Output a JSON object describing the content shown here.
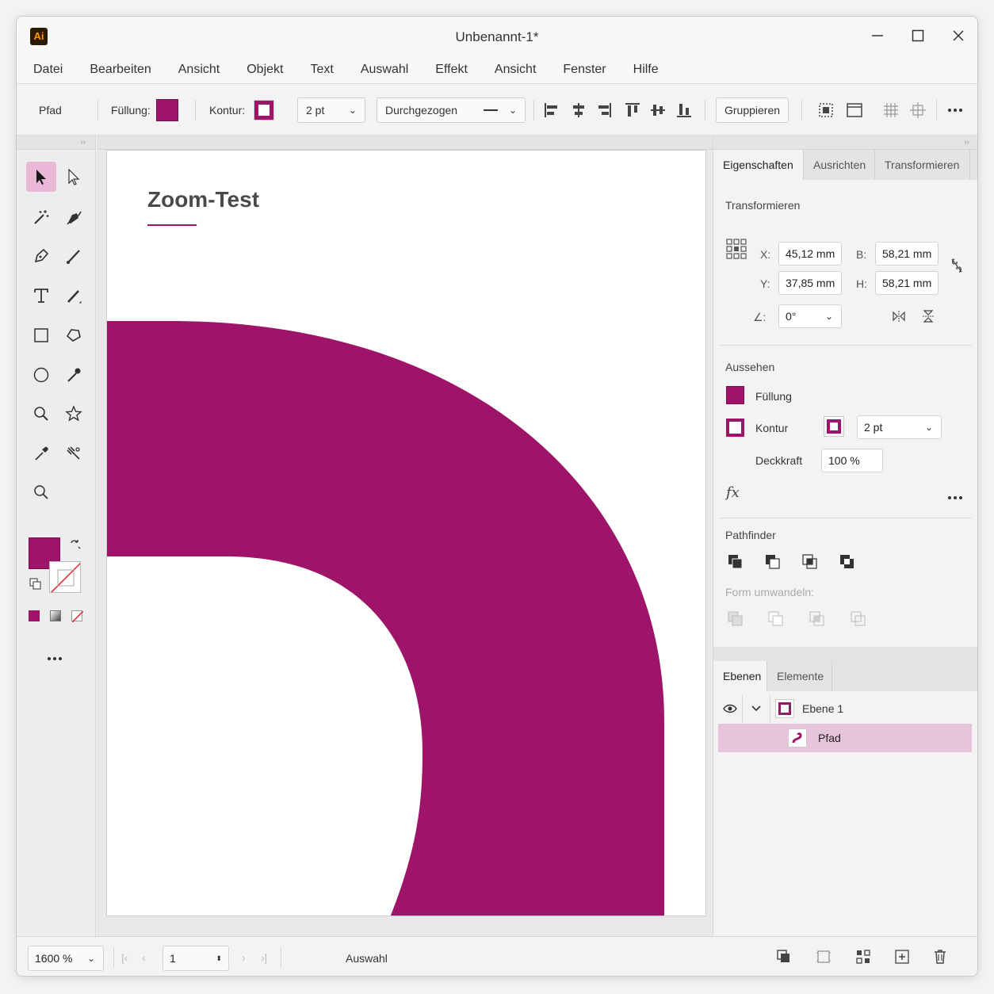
{
  "window": {
    "title": "Unbenannt-1*",
    "app_icon_text": "Ai"
  },
  "menu": [
    "Datei",
    "Bearbeiten",
    "Ansicht",
    "Objekt",
    "Text",
    "Auswahl",
    "Effekt",
    "Ansicht",
    "Fenster",
    "Hilfe"
  ],
  "controlbar": {
    "object_type": "Pfad",
    "fill_label": "Füllung:",
    "stroke_label": "Kontur:",
    "stroke_weight": "2 pt",
    "stroke_style": "Durchgezogen",
    "group_button": "Gruppieren"
  },
  "colors": {
    "accent": "#9e1468",
    "active_tool_bg": "#e8b8d6",
    "selected_layer_bg": "#e6c4d9"
  },
  "artboard": {
    "heading": "Zoom-Test"
  },
  "properties": {
    "tabs": [
      "Eigenschaften",
      "Ausrichten",
      "Transformieren"
    ],
    "transform_title": "Transformieren",
    "x_label": "X:",
    "x_value": "45,12 mm",
    "y_label": "Y:",
    "y_value": "37,85 mm",
    "w_label": "B:",
    "w_value": "58,21 mm",
    "h_label": "H:",
    "h_value": "58,21 mm",
    "angle_label": "∠:",
    "angle_value": "0°",
    "appearance_title": "Aussehen",
    "fill_label": "Füllung",
    "stroke_label": "Kontur",
    "stroke_weight": "2 pt",
    "opacity_label": "Deckkraft",
    "opacity_value": "100 %",
    "fx_label": "fx",
    "pathfinder_title": "Pathfinder",
    "shape_modes_title": "Form umwandeln:"
  },
  "layers": {
    "tabs": [
      "Ebenen",
      "Elemente"
    ],
    "layer_name": "Ebene 1",
    "sublayer_name": "Pfad"
  },
  "status": {
    "zoom": "1600 %",
    "artboard_number": "1",
    "tool_name": "Auswahl"
  }
}
